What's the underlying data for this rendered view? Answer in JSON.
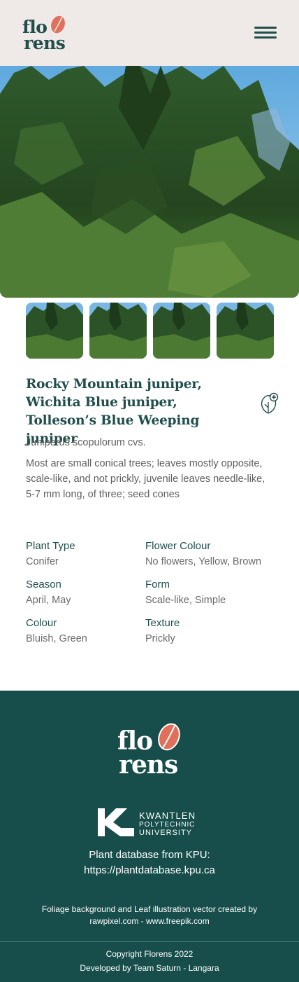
{
  "header": {
    "logo_line1": "flo",
    "logo_line2": "rens",
    "menu_icon": "hamburger-menu-icon"
  },
  "gallery": {
    "thumbnail_count": 4
  },
  "plant": {
    "common_name": "Rocky Mountain juniper, Wichita Blue juniper, Tolleson’s Blue Weeping juniper",
    "scientific_name": "Juniperus scopulorum cvs.",
    "description": "Most are small conical trees; leaves mostly opposite, scale-like, and not prickly, juvenile leaves needle-like, 5-7 mm long, of three; seed cones",
    "add_icon": "leaf-plus-icon",
    "attributes": [
      {
        "label": "Plant Type",
        "value": "Conifer"
      },
      {
        "label": "Flower Colour",
        "value": "No flowers, Yellow, Brown"
      },
      {
        "label": "Season",
        "value": "April, May"
      },
      {
        "label": "Form",
        "value": "Scale-like, Simple"
      },
      {
        "label": "Colour",
        "value": "Bluish, Green"
      },
      {
        "label": "Texture",
        "value": "Prickly"
      }
    ]
  },
  "footer": {
    "logo_line1": "flo",
    "logo_line2": "rens",
    "kpu_line1": "KWANTLEN",
    "kpu_line2": "POLYTECHNIC",
    "kpu_line3": "UNIVERSITY",
    "db_line1": "Plant database from KPU:",
    "db_line2": "https://plantdatabase.kpu.ca",
    "credit": "Foliage background and Leaf illustration vector created by rawpixel.com - www.freepik.com",
    "copyright": "Copyright Florens 2022",
    "developed_by": "Developed by Team Saturn - Langara"
  },
  "colors": {
    "primary": "#1f4e4b",
    "footer_bg": "#174e4b",
    "header_bg": "#efe9e8",
    "accent_leaf": "#e0705c"
  }
}
